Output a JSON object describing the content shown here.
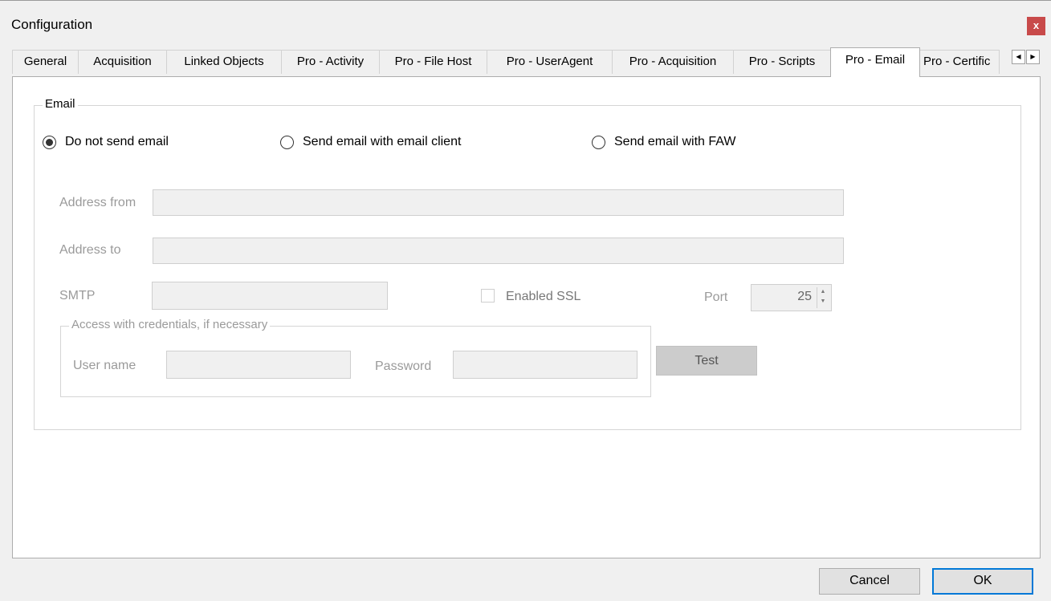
{
  "window": {
    "title": "Configuration",
    "close_glyph": "x"
  },
  "tabs": [
    {
      "label": "General"
    },
    {
      "label": "Acquisition"
    },
    {
      "label": "Linked Objects"
    },
    {
      "label": "Pro - Activity"
    },
    {
      "label": "Pro - File Host"
    },
    {
      "label": "Pro - UserAgent"
    },
    {
      "label": "Pro - Acquisition"
    },
    {
      "label": "Pro - Scripts"
    },
    {
      "label": "Pro - Email"
    },
    {
      "label": "Pro - Certific"
    }
  ],
  "active_tab": "Pro - Email",
  "tab_scroll": {
    "left": "◀",
    "right": "▶"
  },
  "email_group": {
    "legend": "Email",
    "options": [
      {
        "label": "Do not send email",
        "selected": true
      },
      {
        "label": "Send email with email client",
        "selected": false
      },
      {
        "label": "Send email with FAW",
        "selected": false
      }
    ],
    "address_from": {
      "label": "Address from",
      "value": ""
    },
    "address_to": {
      "label": "Address to",
      "value": ""
    },
    "smtp": {
      "label": "SMTP",
      "value": ""
    },
    "ssl": {
      "label": "Enabled SSL",
      "checked": false
    },
    "port": {
      "label": "Port",
      "value": "25",
      "up": "▲",
      "down": "▼"
    },
    "credentials": {
      "legend": "Access with credentials, if necessary",
      "username": {
        "label": "User name",
        "value": ""
      },
      "password": {
        "label": "Password",
        "value": ""
      }
    },
    "test_label": "Test"
  },
  "footer": {
    "cancel_label": "Cancel",
    "ok_label": "OK"
  }
}
